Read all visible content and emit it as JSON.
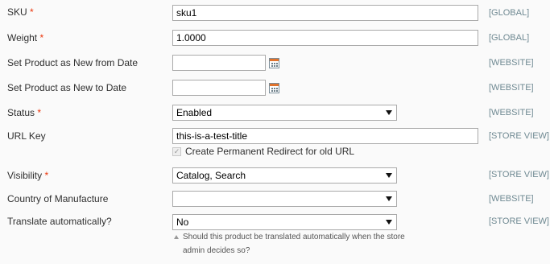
{
  "fields": {
    "sku": {
      "label": "SKU",
      "required": "*",
      "value": "sku1",
      "scope": "[GLOBAL]"
    },
    "weight": {
      "label": "Weight",
      "required": "*",
      "value": "1.0000",
      "scope": "[GLOBAL]"
    },
    "new_from": {
      "label": "Set Product as New from Date",
      "value": "",
      "scope": "[WEBSITE]"
    },
    "new_to": {
      "label": "Set Product as New to Date",
      "value": "",
      "scope": "[WEBSITE]"
    },
    "status": {
      "label": "Status",
      "required": "*",
      "value": "Enabled",
      "scope": "[WEBSITE]"
    },
    "url_key": {
      "label": "URL Key",
      "value": "this-is-a-test-title",
      "scope": "[STORE VIEW]",
      "checkbox_label": "Create Permanent Redirect for old URL",
      "checkbox_mark": "✓"
    },
    "visibility": {
      "label": "Visibility",
      "required": "*",
      "value": "Catalog, Search",
      "scope": "[STORE VIEW]"
    },
    "country": {
      "label": "Country of Manufacture",
      "value": "",
      "scope": "[WEBSITE]"
    },
    "translate": {
      "label": "Translate automatically?",
      "value": "No",
      "scope": "[STORE VIEW]",
      "note": "Should this product be translated automatically when the store admin decides so?"
    }
  },
  "colors": {
    "required": "#eb340a",
    "scope": "#6f8992",
    "background": "#fafafa"
  }
}
